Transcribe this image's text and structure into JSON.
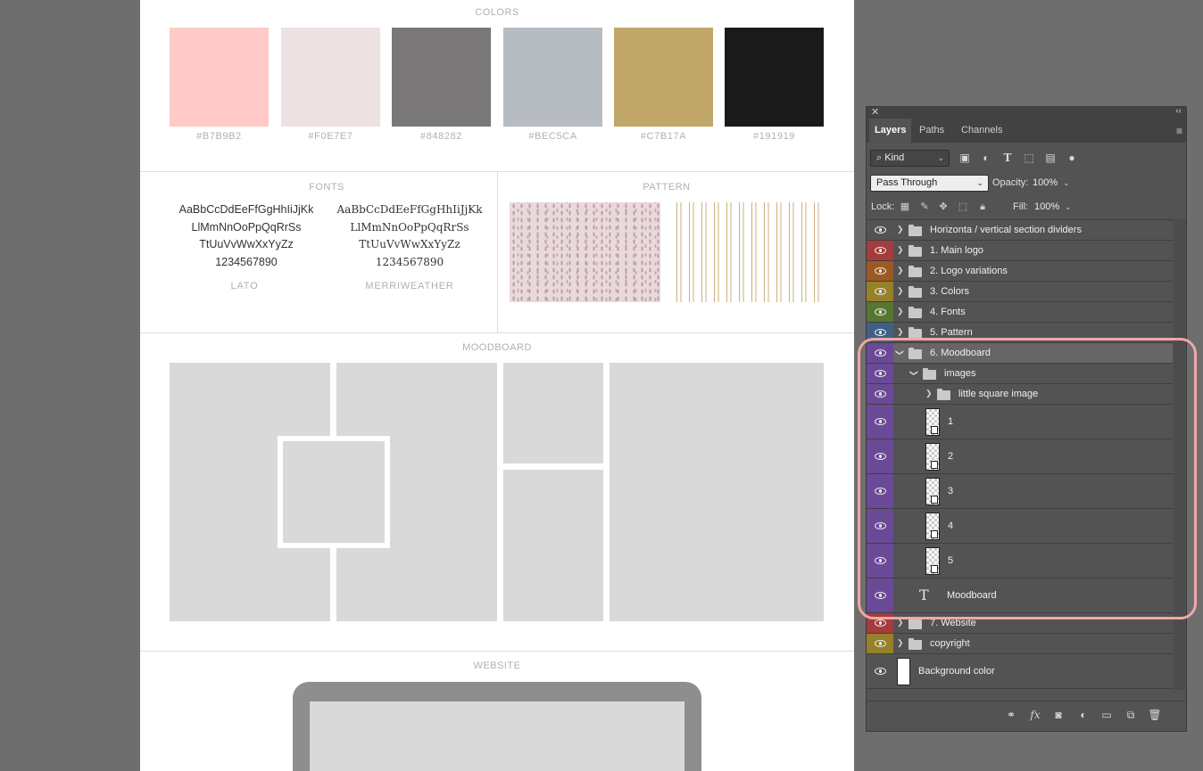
{
  "document": {
    "colors_title": "COLORS",
    "swatches": [
      {
        "hex_label": "#B7B9B2",
        "color": "#ffcac8"
      },
      {
        "hex_label": "#F0E7E7",
        "color": "#ede1e1"
      },
      {
        "hex_label": "#848282",
        "color": "#797777"
      },
      {
        "hex_label": "#BEC5CA",
        "color": "#b6bcc2"
      },
      {
        "hex_label": "#C7B17A",
        "color": "#c1a76a"
      },
      {
        "hex_label": "#191919",
        "color": "#1a1a1a"
      }
    ],
    "fonts_title": "FONTS",
    "font_sample_lines": [
      "AaBbCcDdEeFfGgHhIiJjKk",
      "LlMmNnOoPpQqRrSs",
      "TtUuVvWwXxYyZz",
      "1234567890"
    ],
    "font_lato_label": "LATO",
    "font_merri_label": "MERRIWEATHER",
    "pattern_title": "PATTERN",
    "moodboard_title": "MOODBOARD",
    "website_title": "WEBSITE"
  },
  "panel": {
    "close_glyph": "✕",
    "collapse_glyph": "‹‹",
    "tabs": [
      "Layers",
      "Paths",
      "Channels"
    ],
    "menu_glyph": "≡",
    "kind_filter": "Kind",
    "blend_mode": "Pass Through",
    "opacity_label": "Opacity:",
    "opacity_value": "100%",
    "lock_label": "Lock:",
    "fill_label": "Fill:",
    "fill_value": "100%",
    "layers": [
      {
        "name": "Horizonta / vertical section dividers",
        "tag": "none"
      },
      {
        "name": "1. Main logo",
        "tag": "red"
      },
      {
        "name": "2. Logo variations",
        "tag": "orange"
      },
      {
        "name": "3. Colors",
        "tag": "yellow"
      },
      {
        "name": "4. Fonts",
        "tag": "green"
      },
      {
        "name": "5. Pattern",
        "tag": "blue"
      },
      {
        "name": "6. Moodboard",
        "tag": "violet"
      },
      {
        "name": "images",
        "tag": "violet"
      },
      {
        "name": "little square image",
        "tag": "violet"
      },
      {
        "name": "1",
        "tag": "violet"
      },
      {
        "name": "2",
        "tag": "violet"
      },
      {
        "name": "3",
        "tag": "violet"
      },
      {
        "name": "4",
        "tag": "violet"
      },
      {
        "name": "5",
        "tag": "violet"
      },
      {
        "name": "Moodboard",
        "tag": "violet"
      },
      {
        "name": "7. Website",
        "tag": "red"
      },
      {
        "name": "copyright",
        "tag": "yellow"
      },
      {
        "name": "Background color",
        "tag": "none"
      }
    ],
    "tag_colors": {
      "red": "#a33c3c",
      "orange": "#9a5a22",
      "yellow": "#96802a",
      "green": "#55772f",
      "blue": "#3f5f87",
      "violet": "#6a4a96",
      "none": "#535353"
    },
    "highlight_color": "#f2a7a4"
  }
}
